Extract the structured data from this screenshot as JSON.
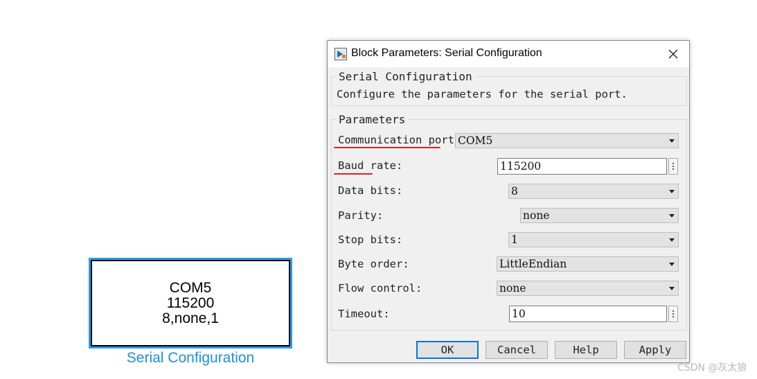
{
  "block": {
    "lines": [
      "COM5",
      "115200",
      "8,none,1"
    ],
    "name": "Serial Configuration"
  },
  "dialog": {
    "title": "Block Parameters: Serial Configuration",
    "icon": "simulink-block-icon",
    "close_icon": "close-icon",
    "description_group": {
      "legend": "Serial Configuration",
      "text": "Configure the parameters for the serial port."
    },
    "parameters_group": {
      "legend": "Parameters",
      "fields": [
        {
          "label": "Communication port:",
          "value": "COM5",
          "kind": "dropdown",
          "underlined": true
        },
        {
          "label": "Baud rate:",
          "value": "115200",
          "kind": "text",
          "underlined": true
        },
        {
          "label": "Data bits:",
          "value": "8",
          "kind": "dropdown"
        },
        {
          "label": "Parity:",
          "value": "none",
          "kind": "dropdown"
        },
        {
          "label": "Stop bits:",
          "value": "1",
          "kind": "dropdown"
        },
        {
          "label": "Byte order:",
          "value": "LittleEndian",
          "kind": "dropdown"
        },
        {
          "label": "Flow control:",
          "value": "none",
          "kind": "dropdown"
        },
        {
          "label": "Timeout:",
          "value": "10",
          "kind": "text"
        }
      ]
    },
    "buttons": {
      "ok": "OK",
      "cancel": "Cancel",
      "help": "Help",
      "apply": "Apply"
    }
  },
  "watermark": "CSDN @灰太狼",
  "colors": {
    "block_selection": "#2f9be9",
    "block_name": "#1d8fe0",
    "annotation_underline": "#e02020",
    "primary_button_border": "#0078d7"
  }
}
